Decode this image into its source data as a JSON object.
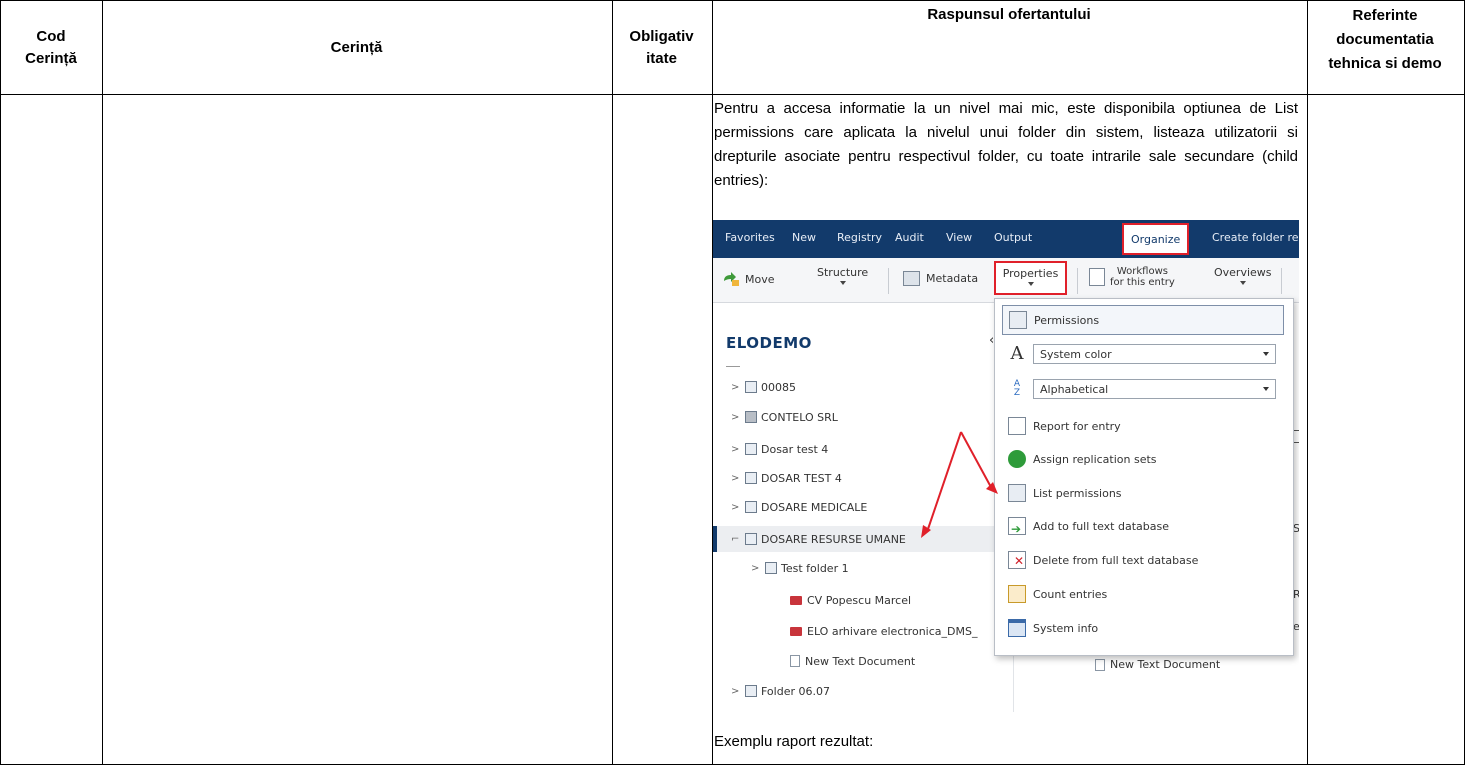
{
  "table": {
    "headers": {
      "cod": "Cod Cerință",
      "cerinta": "Cerință",
      "obligativitate": "Obligativ itate",
      "raspuns": "Raspunsul ofertantului",
      "referinte": "Referinte documentatia tehnica si demo"
    },
    "cod_line1": "Cod",
    "cod_line2": "Cerință",
    "oblig_line1": "Obligativ",
    "oblig_line2": "itate",
    "ref_line1": "Referinte",
    "ref_line2": "documentatia",
    "ref_line3": "tehnica si demo",
    "paragraph": "Pentru a accesa informatie la un nivel mai mic, este disponibila optiunea de List permissions care aplicata la nivelul unui folder din sistem, listeaza utilizatorii si drepturile asociate pentru respectivul folder, cu toate intrarile sale secundare (child entries):",
    "caption": "Exemplu raport rezultat:"
  },
  "screenshot": {
    "menu": [
      "Favorites",
      "New",
      "Registry",
      "Audit",
      "View",
      "Output",
      "Organize",
      "Create folder re"
    ],
    "active_menu": "Organize",
    "toolbar": {
      "move": "Move",
      "structure": "Structure",
      "metadata": "Metadata",
      "properties": "Properties",
      "workflows_1": "Workflows",
      "workflows_2": "for this entry",
      "overviews": "Overviews"
    },
    "repository_title": "ELODEMO",
    "tree": [
      {
        "label": "00085",
        "icon": "folder-icon"
      },
      {
        "label": "CONTELO SRL",
        "icon": "building-icon"
      },
      {
        "label": "Dosar test 4",
        "icon": "folder-icon"
      },
      {
        "label": "DOSAR TEST 4",
        "icon": "folder-icon"
      },
      {
        "label": "DOSARE MEDICALE",
        "icon": "cabinet-icon"
      },
      {
        "label": "DOSARE RESURSE UMANE",
        "icon": "cabinet-icon"
      },
      {
        "label": "Test folder 1",
        "icon": "folder-icon"
      },
      {
        "label": "CV Popescu Marcel",
        "icon": "pdf-icon"
      },
      {
        "label": "ELO arhivare electronica_DMS_",
        "icon": "pdf-icon"
      },
      {
        "label": "New Text Document",
        "icon": "document-icon"
      },
      {
        "label": "Folder 06.07",
        "icon": "cabinet-icon"
      }
    ],
    "dropdown": {
      "permissions": "Permissions",
      "color_select": "System color",
      "sort_select": "Alphabetical",
      "report": "Report for entry",
      "replication": "Assign replication sets",
      "list_permissions": "List permissions",
      "add_fulltext": "Add to full text database",
      "delete_fulltext": "Delete from full text database",
      "count": "Count entries",
      "sysinfo": "System info"
    },
    "right_pane": {
      "doc": "New Text Document",
      "frag1": "S",
      "frag2": "R\\",
      "frag3": "e"
    }
  },
  "colors": {
    "menubar": "#123a6b",
    "highlight_border": "#e0202a",
    "annotation_arrow": "#e0202a"
  }
}
